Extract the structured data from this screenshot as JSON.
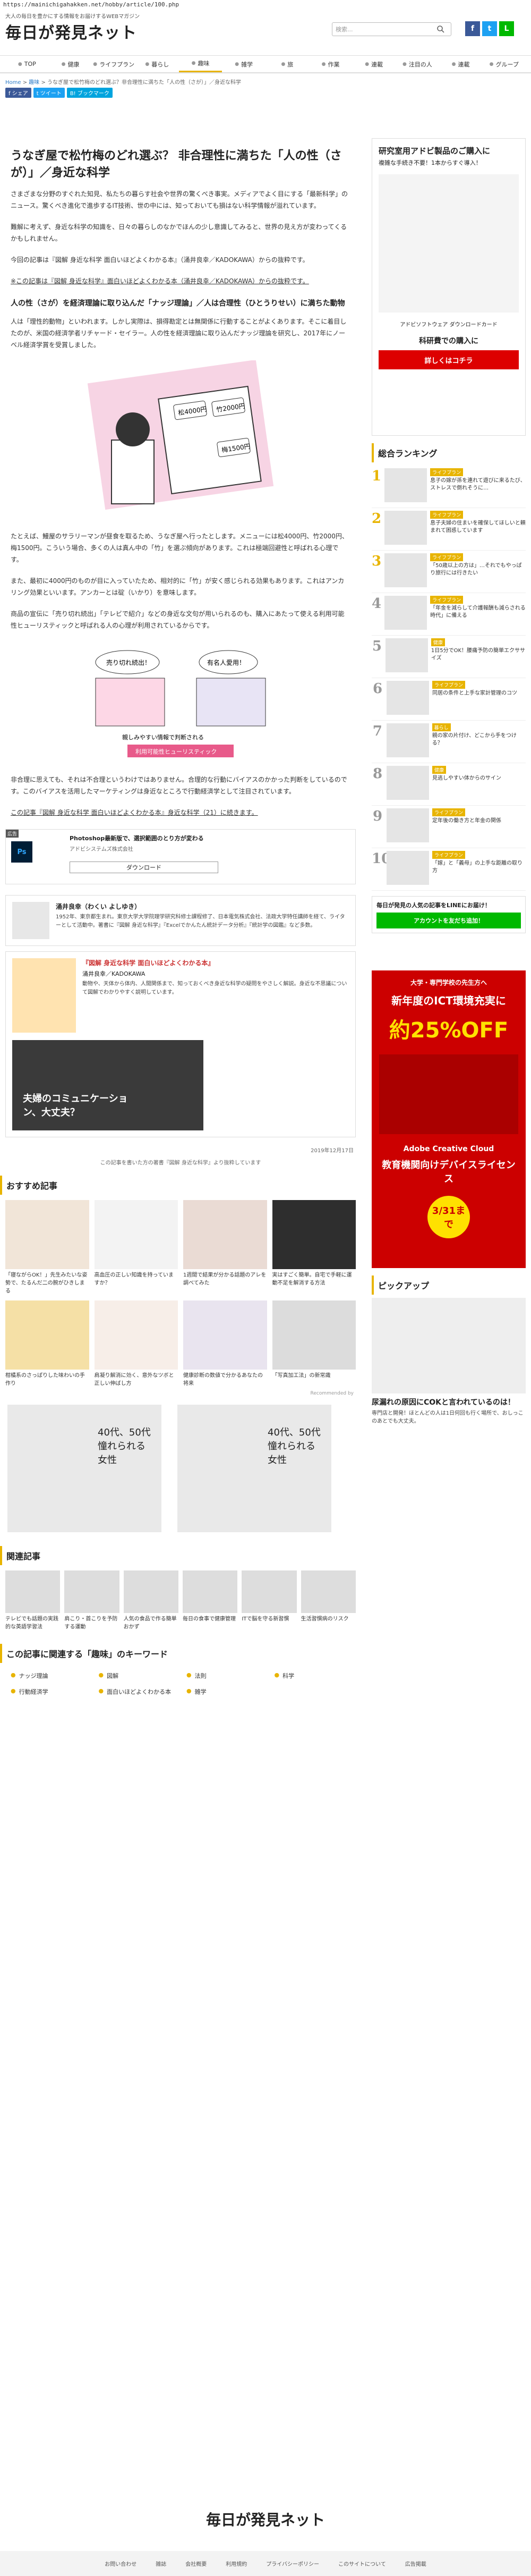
{
  "url": "https://mainichigahakken.net/hobby/article/100.php",
  "header": {
    "tagline": "大人の毎日を豊かにする情報をお届けするWEBマガジン",
    "logo": "毎日が発見ネット",
    "search_placeholder": "検索...",
    "social": [
      "f",
      "t",
      "L"
    ]
  },
  "nav": [
    "TOP",
    "健康",
    "ライフプラン",
    "暮らし",
    "趣味",
    "雑学",
    "旅",
    "作業",
    "連載",
    "注目の人",
    "連載",
    "グループ"
  ],
  "nav_active_index": 4,
  "breadcrumb": [
    "Home",
    "趣味",
    "うなぎ屋で松竹梅のどれ選ぶ？非合理性に満ちた「人の性（さが）」／身近な科学"
  ],
  "share": [
    {
      "label": "f シェア",
      "color": "#3b5998"
    },
    {
      "label": "t ツイート",
      "color": "#1da1f2"
    },
    {
      "label": "B! ブックマーク",
      "color": "#00a4de"
    }
  ],
  "article": {
    "title": "うなぎ屋で松竹梅のどれ選ぶ？ 非合理性に満ちた「人の性（さが）」／身近な科学",
    "p1": "さまざまな分野のすぐれた知見、私たちの暮らす社会や世界の驚くべき事実。メディアでよく目にする「最新科学」のニュース。驚くべき進化で進歩するIT技術、世の中には、知っておいても損はない科学情報が溢れています。",
    "p2": "難解に考えず、身近な科学の知識を、日々の暮らしのなかでほんの少し意識してみると、世界の見え方が変わってくるかもしれません。",
    "p3": "今回の記事は『図解 身近な科学 面白いほどよくわかる本』（涌井良幸／KADOKAWA）からの抜粋です。",
    "p4": "※この記事は『図解 身近な科学』面白いほどよくわかる本（涌井良幸／KADOKAWA）からの抜粋です。",
    "h2": "人の性（さが）を経済理論に取り込んだ「ナッジ理論」／人は合理性（ひとうりせい）に満ちた動物",
    "p5": "人は「理性的動物」といわれます。しかし実際は、損得勘定とは無関係に行動することがよくあります。そこに着目したのが、米国の経済学者リチャード・セイラー。人の性を経済理論に取り込んだナッジ理論を研究し、2017年にノーベル経済学賞を受賞しました。",
    "p6": "たとえば、鰻屋のサラリーマンが昼食を取るため、うなぎ屋へ行ったとします。メニューには松4000円、竹2000円、梅1500円。こういう場合、多くの人は真ん中の「竹」を選ぶ傾向があります。これは極端回避性と呼ばれる心理です。",
    "p7": "また、最初に4000円のものが目に入っていたため、相対的に「竹」が安く感じられる効果もあります。これはアンカリング効果といいます。アンカーとは碇（いかり）を意味します。",
    "p8": "商品の宣伝に「売り切れ続出」「テレビで紹介」などの身近な文句が用いられるのも、購入にあたって使える利用可能性ヒューリスティックと呼ばれる人の心理が利用されているからです。",
    "p9": "非合理に思えても、それは不合理というわけではありません。合理的な行動にバイアスのかかった判断をしているのです。このバイアスを活用したマーケティングは身近なところで行動経済学として注目されています。",
    "p10": "この記事『図解 身近な科学 面白いほどよくわかる本』身近な科学（21）に続きます。",
    "illus1_labels": [
      "松4000円",
      "竹2000円",
      "梅1500円"
    ],
    "illus2_labels": [
      "売り切れ続出！",
      "有名人愛用！",
      "親しみやすい情報で判断される",
      "利用可能性ヒューリスティック"
    ],
    "ad": {
      "tag": "広告",
      "title": "Photoshop最新版で、選択範囲のとり方が変わる",
      "sub": "アドビシステムズ株式会社",
      "btn": "ダウンロード"
    },
    "author": {
      "name": "涌井良幸（わくい よしゆき）",
      "bio": "1952年、東京都生まれ。東京大学大学院理学研究科修士課程修了、日本電気株式会社、法政大学特任講師を経て、ライターとして活動中。著書に『図解 身近な科学』『Excelでかんたん統計データ分析』『統計学の図鑑』など多数。"
    },
    "book": {
      "title": "『図解 身近な科学 面白いほどよくわかる本』",
      "author": "涌井良幸／KADOKAWA",
      "desc": "動物や、天体から体内、人間関係まで、知っておくべき身近な科学の疑問をやさしく解説。身近な不思議について図解でわかりやすく説明しています。",
      "caption": "夫婦のコミュニケーション、大丈夫？"
    },
    "date": "2019年12月17日",
    "note": "この記事を書いた方の著書『図解 身近な科学』より抜粋しています"
  },
  "recommended": {
    "title": "おすすめ記事",
    "items": [
      "「寝ながらOK！」先生みたいな姿勢で、たるんだ二の腕がひきしまる",
      "高血圧の正しい知識を持っていますか？",
      "1週間で結果が分かる話題のアレを調べてみた",
      "実はすごく簡単。自宅で手軽に運動不足を解消する方法",
      "柑橘系のさっぱりした味わいの手作り",
      "肩凝り解消に効く、意外なツボと正しい伸ばし方",
      "健康診断の数値で分かるあなたの将来",
      "「写真加工法」の新常識"
    ],
    "recommended_by": "Recommended by"
  },
  "ad_banners": [
    "40代、50代 憧れられる女性",
    "40代、50代 憧れられる女性"
  ],
  "related": {
    "title": "関連記事",
    "items": [
      "テレビでも話題の実践的な英語学習法",
      "肩こり・首こりを予防する運動",
      "人気の食品で作る簡単おかず",
      "毎日の食事で健康管理",
      "ITで脳を守る新習慣",
      "生活習慣病のリスク"
    ]
  },
  "keywords": {
    "title": "この記事に関連する「趣味」のキーワード",
    "items": [
      "ナッジ理論",
      "図解",
      "法則",
      "科学",
      "行動経済学",
      "面白いほどよくわかる本",
      "雑学"
    ]
  },
  "sidebar": {
    "ad1": {
      "title": "研究室用アドビ製品のご購入に",
      "sub": "複雑な手続き不要！1本からすぐ導入！",
      "product": "アドビソフトウェア ダウンロードカード",
      "cta": "科研費での購入に",
      "btn": "詳しくはコチラ"
    },
    "ranking_title": "総合ランキング",
    "ranking": [
      {
        "cat": "ライフプラン",
        "text": "息子の嫁が孫を連れて遊びに来るたび、ストレスで倒れそうに…"
      },
      {
        "cat": "ライフプラン",
        "text": "息子夫婦の住まいを確保してほしいと頼まれて困惑しています"
      },
      {
        "cat": "ライフプラン",
        "text": "「50歳以上の方は」…それでもやっぱり旅行には行きたい"
      },
      {
        "cat": "ライフプラン",
        "text": "「年金を減らして介護報酬も減らされる時代」に備える"
      },
      {
        "cat": "健康",
        "text": "1日5分でOK！腰痛予防の簡単エクササイズ"
      },
      {
        "cat": "ライフプラン",
        "text": "同居の条件と上手な家計管理のコツ"
      },
      {
        "cat": "暮らし",
        "text": "親の家の片付け、どこから手をつける？"
      },
      {
        "cat": "健康",
        "text": "見逃しやすい体からのサイン"
      },
      {
        "cat": "ライフプラン",
        "text": "定年後の働き方と年金の関係"
      },
      {
        "cat": "ライフプラン",
        "text": "「嫁」と「義母」の上手な距離の取り方"
      }
    ],
    "line": {
      "text": "毎日が発見の人気の記事をLINEにお届け！",
      "btn": "アカウントを友だち追加！"
    },
    "ad2": {
      "top": "大学・専門学校の先生方へ",
      "mid": "新年度のICT環境充実に",
      "pct": "約25%OFF",
      "brand": "Adobe Creative Cloud",
      "edu": "教育機関向けデバイスライセンス",
      "deadline": "3/31まで"
    },
    "pickup_title": "ピックアップ",
    "pickup": {
      "title": "尿漏れの原因にCOKと言われているのは！",
      "desc": "専門店と開発！ほとんどの人は1日何回も行く場所で、おしっこのあとでも大丈夫。"
    }
  },
  "footer": {
    "logo": "毎日が発見ネット",
    "links": [
      "お問い合わせ",
      "雑誌",
      "会社概要",
      "利用規約",
      "プライバシーポリシー",
      "このサイトについて",
      "広告掲載"
    ]
  }
}
